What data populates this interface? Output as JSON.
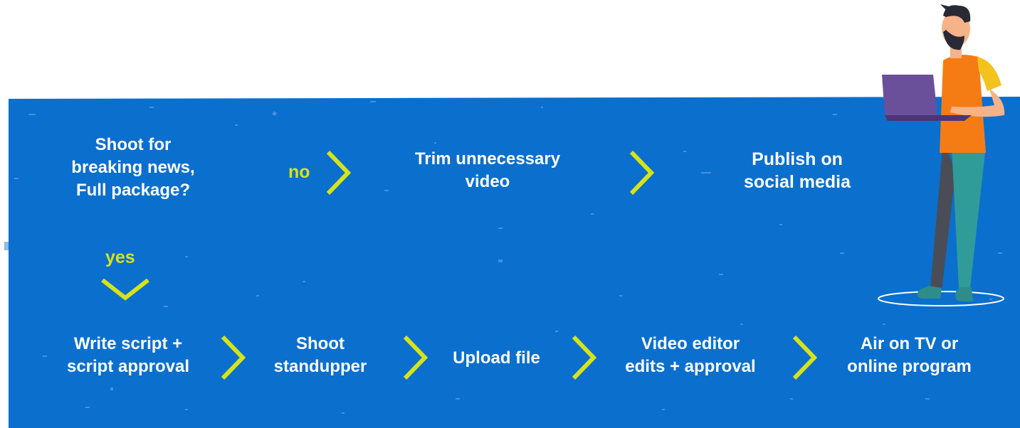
{
  "colors": {
    "panel": "#0b6fce",
    "accent": "#d6e21a",
    "text": "#ffffff"
  },
  "decision": {
    "line1": "Shoot for",
    "line2": "breaking news,",
    "line3": "Full package?"
  },
  "branch_no": "no",
  "branch_yes": "yes",
  "top_row": [
    {
      "line1": "Trim unnecessary",
      "line2": "video"
    },
    {
      "line1": "Publish on",
      "line2": "social media"
    }
  ],
  "bottom_row": [
    {
      "line1": "Write script +",
      "line2": "script approval"
    },
    {
      "line1": "Shoot",
      "line2": "standupper"
    },
    {
      "line1": "Upload file",
      "line2": ""
    },
    {
      "line1": "Video editor",
      "line2": "edits + approval"
    },
    {
      "line1": "Air on TV or",
      "line2": "online program"
    }
  ],
  "illustration": "person-with-laptop"
}
